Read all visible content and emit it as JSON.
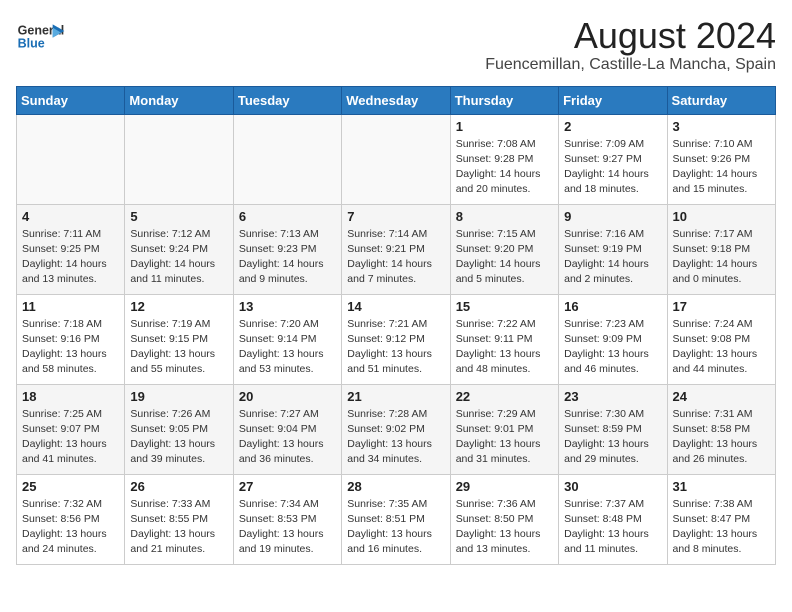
{
  "header": {
    "logo_general": "General",
    "logo_blue": "Blue",
    "title": "August 2024",
    "subtitle": "Fuencemillan, Castille-La Mancha, Spain"
  },
  "calendar": {
    "days_of_week": [
      "Sunday",
      "Monday",
      "Tuesday",
      "Wednesday",
      "Thursday",
      "Friday",
      "Saturday"
    ],
    "weeks": [
      [
        {
          "day": "",
          "info": ""
        },
        {
          "day": "",
          "info": ""
        },
        {
          "day": "",
          "info": ""
        },
        {
          "day": "",
          "info": ""
        },
        {
          "day": "1",
          "info": "Sunrise: 7:08 AM\nSunset: 9:28 PM\nDaylight: 14 hours and 20 minutes."
        },
        {
          "day": "2",
          "info": "Sunrise: 7:09 AM\nSunset: 9:27 PM\nDaylight: 14 hours and 18 minutes."
        },
        {
          "day": "3",
          "info": "Sunrise: 7:10 AM\nSunset: 9:26 PM\nDaylight: 14 hours and 15 minutes."
        }
      ],
      [
        {
          "day": "4",
          "info": "Sunrise: 7:11 AM\nSunset: 9:25 PM\nDaylight: 14 hours and 13 minutes."
        },
        {
          "day": "5",
          "info": "Sunrise: 7:12 AM\nSunset: 9:24 PM\nDaylight: 14 hours and 11 minutes."
        },
        {
          "day": "6",
          "info": "Sunrise: 7:13 AM\nSunset: 9:23 PM\nDaylight: 14 hours and 9 minutes."
        },
        {
          "day": "7",
          "info": "Sunrise: 7:14 AM\nSunset: 9:21 PM\nDaylight: 14 hours and 7 minutes."
        },
        {
          "day": "8",
          "info": "Sunrise: 7:15 AM\nSunset: 9:20 PM\nDaylight: 14 hours and 5 minutes."
        },
        {
          "day": "9",
          "info": "Sunrise: 7:16 AM\nSunset: 9:19 PM\nDaylight: 14 hours and 2 minutes."
        },
        {
          "day": "10",
          "info": "Sunrise: 7:17 AM\nSunset: 9:18 PM\nDaylight: 14 hours and 0 minutes."
        }
      ],
      [
        {
          "day": "11",
          "info": "Sunrise: 7:18 AM\nSunset: 9:16 PM\nDaylight: 13 hours and 58 minutes."
        },
        {
          "day": "12",
          "info": "Sunrise: 7:19 AM\nSunset: 9:15 PM\nDaylight: 13 hours and 55 minutes."
        },
        {
          "day": "13",
          "info": "Sunrise: 7:20 AM\nSunset: 9:14 PM\nDaylight: 13 hours and 53 minutes."
        },
        {
          "day": "14",
          "info": "Sunrise: 7:21 AM\nSunset: 9:12 PM\nDaylight: 13 hours and 51 minutes."
        },
        {
          "day": "15",
          "info": "Sunrise: 7:22 AM\nSunset: 9:11 PM\nDaylight: 13 hours and 48 minutes."
        },
        {
          "day": "16",
          "info": "Sunrise: 7:23 AM\nSunset: 9:09 PM\nDaylight: 13 hours and 46 minutes."
        },
        {
          "day": "17",
          "info": "Sunrise: 7:24 AM\nSunset: 9:08 PM\nDaylight: 13 hours and 44 minutes."
        }
      ],
      [
        {
          "day": "18",
          "info": "Sunrise: 7:25 AM\nSunset: 9:07 PM\nDaylight: 13 hours and 41 minutes."
        },
        {
          "day": "19",
          "info": "Sunrise: 7:26 AM\nSunset: 9:05 PM\nDaylight: 13 hours and 39 minutes."
        },
        {
          "day": "20",
          "info": "Sunrise: 7:27 AM\nSunset: 9:04 PM\nDaylight: 13 hours and 36 minutes."
        },
        {
          "day": "21",
          "info": "Sunrise: 7:28 AM\nSunset: 9:02 PM\nDaylight: 13 hours and 34 minutes."
        },
        {
          "day": "22",
          "info": "Sunrise: 7:29 AM\nSunset: 9:01 PM\nDaylight: 13 hours and 31 minutes."
        },
        {
          "day": "23",
          "info": "Sunrise: 7:30 AM\nSunset: 8:59 PM\nDaylight: 13 hours and 29 minutes."
        },
        {
          "day": "24",
          "info": "Sunrise: 7:31 AM\nSunset: 8:58 PM\nDaylight: 13 hours and 26 minutes."
        }
      ],
      [
        {
          "day": "25",
          "info": "Sunrise: 7:32 AM\nSunset: 8:56 PM\nDaylight: 13 hours and 24 minutes."
        },
        {
          "day": "26",
          "info": "Sunrise: 7:33 AM\nSunset: 8:55 PM\nDaylight: 13 hours and 21 minutes."
        },
        {
          "day": "27",
          "info": "Sunrise: 7:34 AM\nSunset: 8:53 PM\nDaylight: 13 hours and 19 minutes."
        },
        {
          "day": "28",
          "info": "Sunrise: 7:35 AM\nSunset: 8:51 PM\nDaylight: 13 hours and 16 minutes."
        },
        {
          "day": "29",
          "info": "Sunrise: 7:36 AM\nSunset: 8:50 PM\nDaylight: 13 hours and 13 minutes."
        },
        {
          "day": "30",
          "info": "Sunrise: 7:37 AM\nSunset: 8:48 PM\nDaylight: 13 hours and 11 minutes."
        },
        {
          "day": "31",
          "info": "Sunrise: 7:38 AM\nSunset: 8:47 PM\nDaylight: 13 hours and 8 minutes."
        }
      ]
    ]
  }
}
